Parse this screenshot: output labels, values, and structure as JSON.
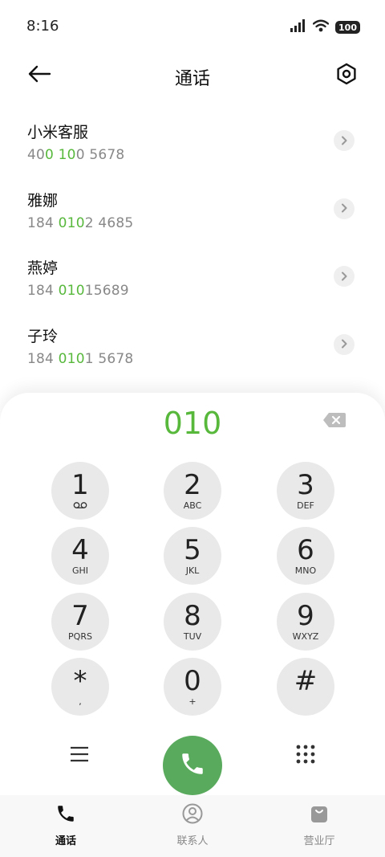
{
  "status_bar": {
    "time": "8:16",
    "battery": "100"
  },
  "header": {
    "title": "通话"
  },
  "contacts": [
    {
      "name": "小米客服",
      "num_a": "40",
      "num_hl": "0 10",
      "num_b": "0 5678"
    },
    {
      "name": "雅娜",
      "num_a": "184 ",
      "num_hl": "010",
      "num_b": "2 4685"
    },
    {
      "name": "燕婷",
      "num_a": "184 ",
      "num_hl": "010",
      "num_b": "15689"
    },
    {
      "name": "子玲",
      "num_a": "184 ",
      "num_hl": "010",
      "num_b": "1 5678"
    }
  ],
  "dialer": {
    "display": "010",
    "keys": [
      {
        "digit": "1",
        "letters": ""
      },
      {
        "digit": "2",
        "letters": "ABC"
      },
      {
        "digit": "3",
        "letters": "DEF"
      },
      {
        "digit": "4",
        "letters": "GHI"
      },
      {
        "digit": "5",
        "letters": "JKL"
      },
      {
        "digit": "6",
        "letters": "MNO"
      },
      {
        "digit": "7",
        "letters": "PQRS"
      },
      {
        "digit": "8",
        "letters": "TUV"
      },
      {
        "digit": "9",
        "letters": "WXYZ"
      },
      {
        "digit": "*",
        "letters": ","
      },
      {
        "digit": "0",
        "letters": "+"
      },
      {
        "digit": "#",
        "letters": ""
      }
    ]
  },
  "tabs": [
    {
      "label": "通话",
      "icon": "phone-icon",
      "active": true
    },
    {
      "label": "联系人",
      "icon": "person-icon",
      "active": false
    },
    {
      "label": "营业厅",
      "icon": "shopping-bag-icon",
      "active": false
    }
  ],
  "colors": {
    "accent": "#57b83c",
    "call_button": "#5aaa5e",
    "key_bg": "#e9e9e9"
  }
}
